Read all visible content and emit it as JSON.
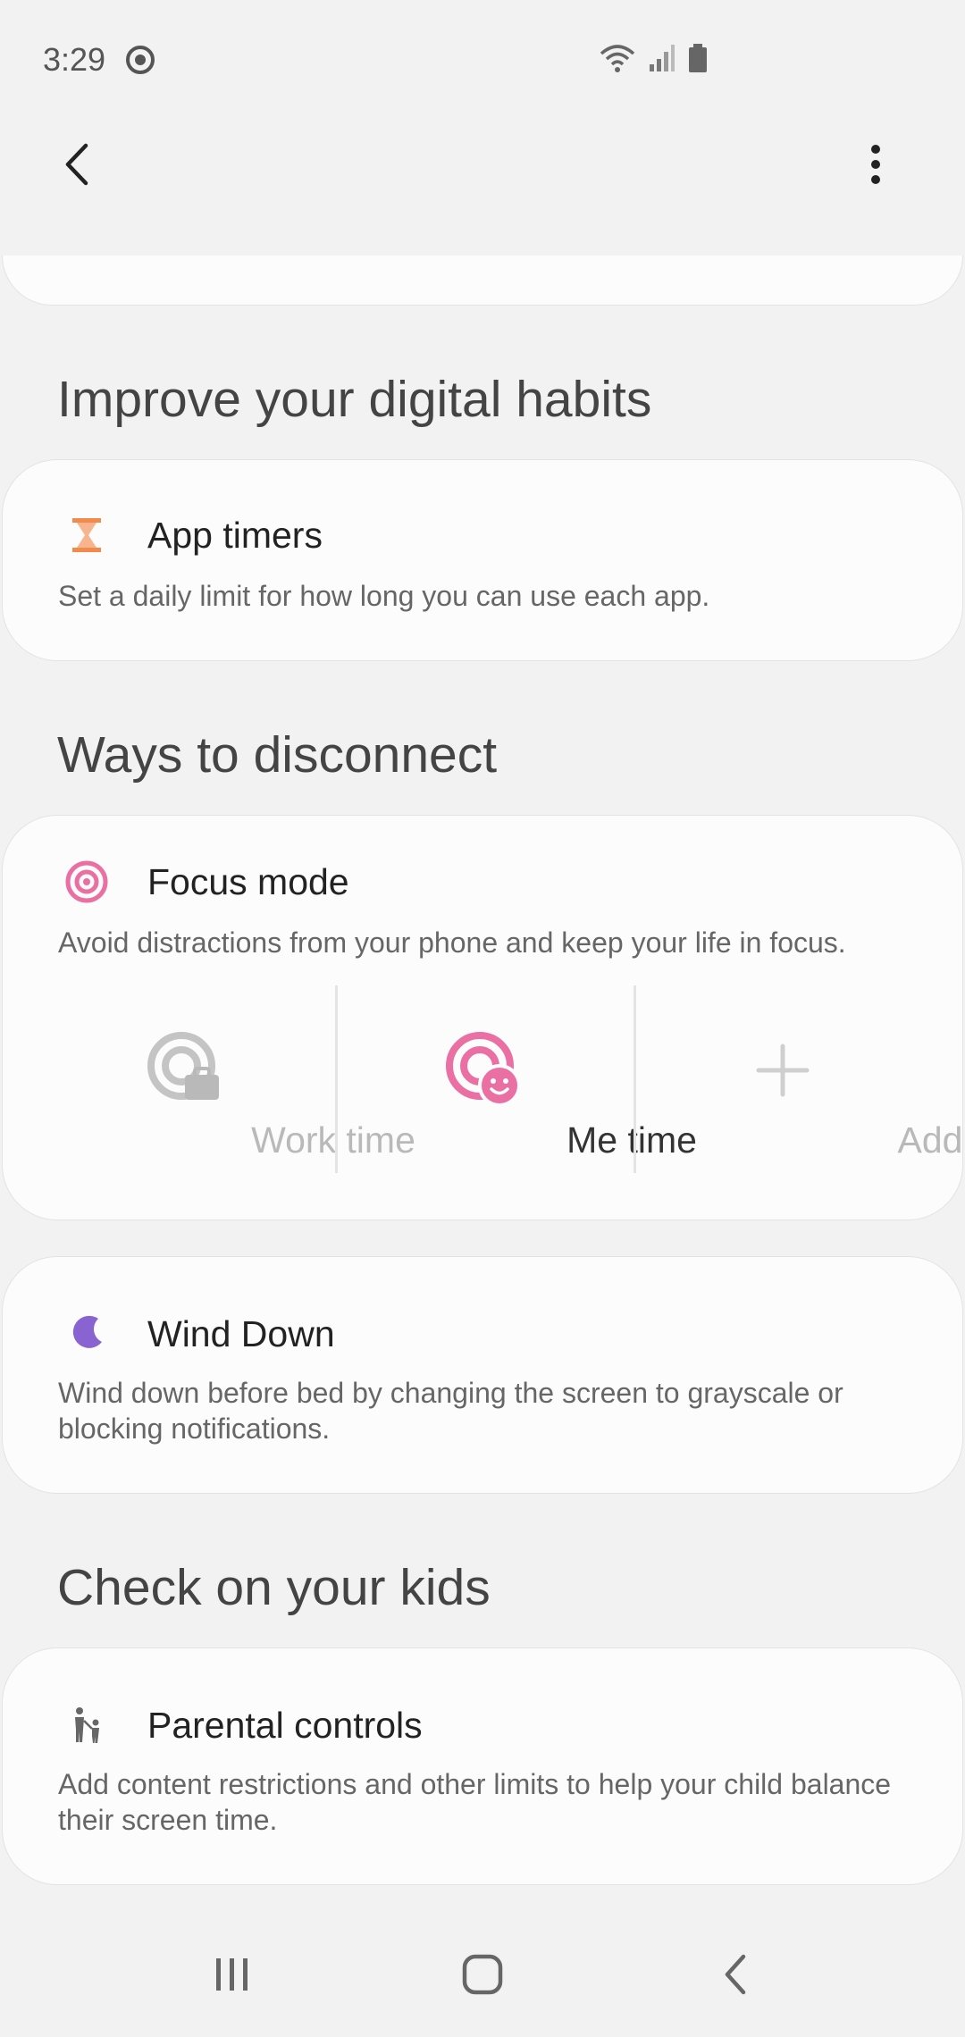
{
  "status_bar": {
    "time": "3:29"
  },
  "sections": {
    "improve": {
      "title": "Improve your digital habits",
      "app_timers": {
        "title": "App timers",
        "desc": "Set a daily limit for how long you can use each app."
      }
    },
    "disconnect": {
      "title": "Ways to disconnect",
      "focus": {
        "title": "Focus mode",
        "desc": "Avoid distractions from your phone and keep your life in focus.",
        "modes": [
          {
            "label": "Work time"
          },
          {
            "label": "Me time"
          },
          {
            "label": "Add"
          }
        ]
      },
      "wind_down": {
        "title": "Wind Down",
        "desc": "Wind down before bed by changing the screen to grayscale or blocking notifications."
      }
    },
    "kids": {
      "title": "Check on your kids",
      "parental": {
        "title": "Parental controls",
        "desc": "Add content restrictions and other limits to help your child balance their screen time."
      }
    }
  },
  "colors": {
    "background": "#f2f2f2",
    "card": "#fcfcfc",
    "hourglass": "#f28a4b",
    "focus_pink": "#ea6fa2",
    "moon_purple": "#8a63d2",
    "disabled_gray": "#b9b9b9"
  }
}
